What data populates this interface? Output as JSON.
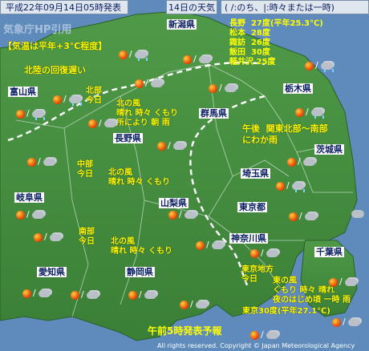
{
  "header": {
    "issued": "平成22年09月14日05時発表",
    "day": "14日の天気",
    "legend": "( /:のち、|:時々または一時)"
  },
  "notes": {
    "source": "気象庁HP引用",
    "temp_note": "【気温は平年+3℃程度】",
    "hokuriku_note": "北陸の回復遅い",
    "afternoon": "午後  関東北部～南部\nにわか雨",
    "footer": "午前5時発表予報",
    "copyright": "All rights reserved. Copyright © Japan Meteorological Agency"
  },
  "city_temps": "長野  27度(平年25.3℃)\n松本  28度\n諏訪  26度\n飯田  30度\n軽井沢 25度",
  "prefectures": {
    "niigata": "新潟県",
    "toyama": "富山県",
    "nagano": "長野県",
    "gunma": "群馬県",
    "tochigi": "栃木県",
    "ibaraki": "茨城県",
    "saitama": "埼玉県",
    "tokyo": "東京都",
    "gifu": "岐阜県",
    "yamanashi": "山梨県",
    "kanagawa": "神奈川県",
    "chiba": "千葉県",
    "aichi": "愛知県",
    "shizuoka": "静岡県"
  },
  "region_forecasts": {
    "hokubu": "北部\n今日",
    "hokubu_detail": "北の風\n晴れ 時々 くもり\n所により 朝 雨",
    "chubu": "中部\n今日",
    "chubu_detail": "北の風\n晴れ 時々 くもり",
    "nanbu": "南部\n今日",
    "nanbu_detail": "北の風\n晴れ 時々 くもり",
    "tokyo_area": "東京地方\n今日",
    "tokyo_detail": "東の風\nくもり 時々 晴れ\n夜のはじめ頃 一時 雨",
    "tokyo_temp": "東京30度(平年27.1℃)"
  },
  "colors": {
    "sea": "#5e8bbb",
    "land": "#3f8a3c",
    "land_dark": "#2f6b2c",
    "boundary": "#ffffff",
    "text_yellow": "#ffff00",
    "label_navy": "#0a1e64"
  }
}
